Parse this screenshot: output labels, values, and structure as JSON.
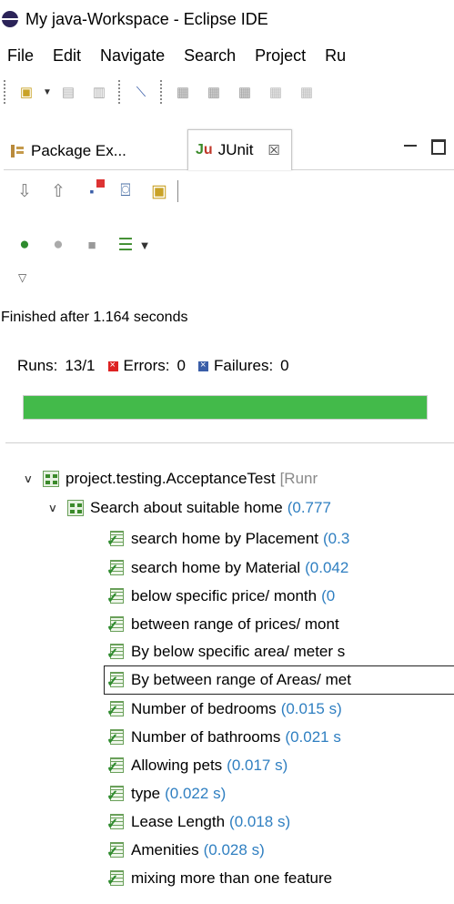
{
  "window": {
    "title": "My java-Workspace - Eclipse IDE"
  },
  "menubar": {
    "items": [
      "File",
      "Edit",
      "Navigate",
      "Search",
      "Project",
      "Ru"
    ]
  },
  "views": {
    "package_explorer_tab": "Package Ex...",
    "junit_tab": "JUnit",
    "junit_tab_close": "☒"
  },
  "junit": {
    "status": "Finished after 1.164 seconds",
    "runs_label": "Runs:",
    "runs_value": "13/1",
    "errors_label": "Errors:",
    "errors_value": "0",
    "failures_label": "Failures:",
    "failures_value": "0",
    "progress_fraction": 1.0,
    "progress_color": "#43ba4a"
  },
  "tree": {
    "root": {
      "label": "project.testing.AcceptanceTest",
      "suffix": "[Runr"
    },
    "suite": {
      "label": "Search about suitable home",
      "time": "(0.777"
    },
    "tests": [
      {
        "label": "search home by Placement",
        "time": "(0.3"
      },
      {
        "label": "search home by Material",
        "time": "(0.042"
      },
      {
        "label": "below specific price/ month",
        "time": "(0"
      },
      {
        "label": "between range of prices/ mont",
        "time": ""
      },
      {
        "label": "By below specific area/ meter s",
        "time": ""
      },
      {
        "label": "By between range of Areas/ met",
        "time": ""
      },
      {
        "label": "Number of bedrooms",
        "time": "(0.015 s)"
      },
      {
        "label": "Number of bathrooms",
        "time": "(0.021 s"
      },
      {
        "label": "Allowing pets",
        "time": "(0.017 s)"
      },
      {
        "label": "type",
        "time": "(0.022 s)"
      },
      {
        "label": "Lease Length",
        "time": "(0.018 s)"
      },
      {
        "label": "Amenities",
        "time": "(0.028 s)"
      },
      {
        "label": "mixing more than one feature",
        "time": ""
      }
    ]
  }
}
